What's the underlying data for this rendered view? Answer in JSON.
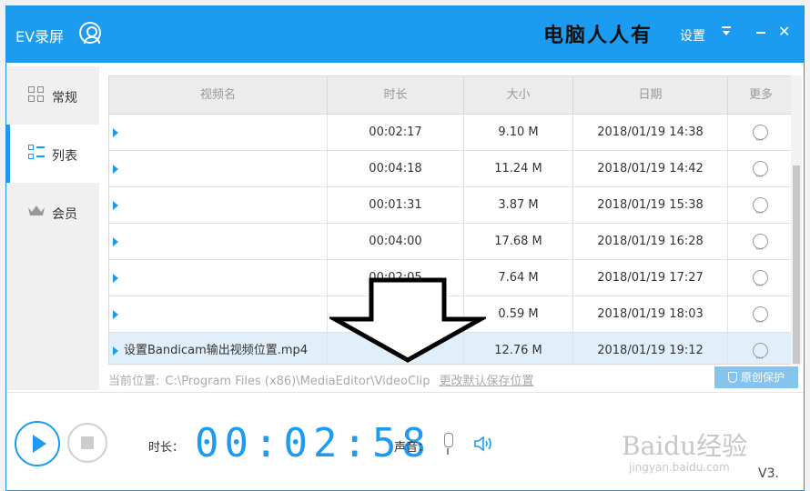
{
  "window": {
    "app_title": "EV录屏",
    "watermark_text": "电脑人人有",
    "settings_label": "设置",
    "accent_color": "#1b9cf0"
  },
  "sidebar": {
    "items": [
      {
        "label": "常规",
        "icon": "grid-icon"
      },
      {
        "label": "列表",
        "icon": "list-icon",
        "active": true
      },
      {
        "label": "会员",
        "icon": "crown-icon"
      }
    ]
  },
  "table": {
    "headers": [
      "视频名",
      "时长",
      "大小",
      "日期",
      "更多"
    ],
    "rows": [
      {
        "name": "",
        "duration": "00:02:17",
        "size": "9.10 M",
        "date": "2018/01/19 14:38"
      },
      {
        "name": "",
        "duration": "00:04:18",
        "size": "11.24 M",
        "date": "2018/01/19 14:42"
      },
      {
        "name": "",
        "duration": "00:01:31",
        "size": "3.87 M",
        "date": "2018/01/19 15:38"
      },
      {
        "name": "",
        "duration": "00:04:00",
        "size": "17.68 M",
        "date": "2018/01/19 16:28"
      },
      {
        "name": "",
        "duration": "00:02:05",
        "size": "7.64 M",
        "date": "2018/01/19 17:27"
      },
      {
        "name": "",
        "duration": "",
        "size": "0.59 M",
        "date": "2018/01/19 18:03"
      },
      {
        "name": "设置Bandicam输出视频位置.mp4",
        "duration": "0",
        "size": "12.76 M",
        "date": "2018/01/19 19:12",
        "selected": true
      }
    ]
  },
  "location": {
    "label": "当前位置:",
    "path": "C:\\Program Files (x86)\\MediaEditor\\VideoClip",
    "change_link": "更改默认保存位置"
  },
  "protect_button": "原创保护",
  "player": {
    "duration_label": "时长：",
    "timer": "00:02:58",
    "sound_label": "声音："
  },
  "branding": {
    "logo": "Baidu经验",
    "logo_sub": "jingyan.baidu.com",
    "version": "V3."
  }
}
